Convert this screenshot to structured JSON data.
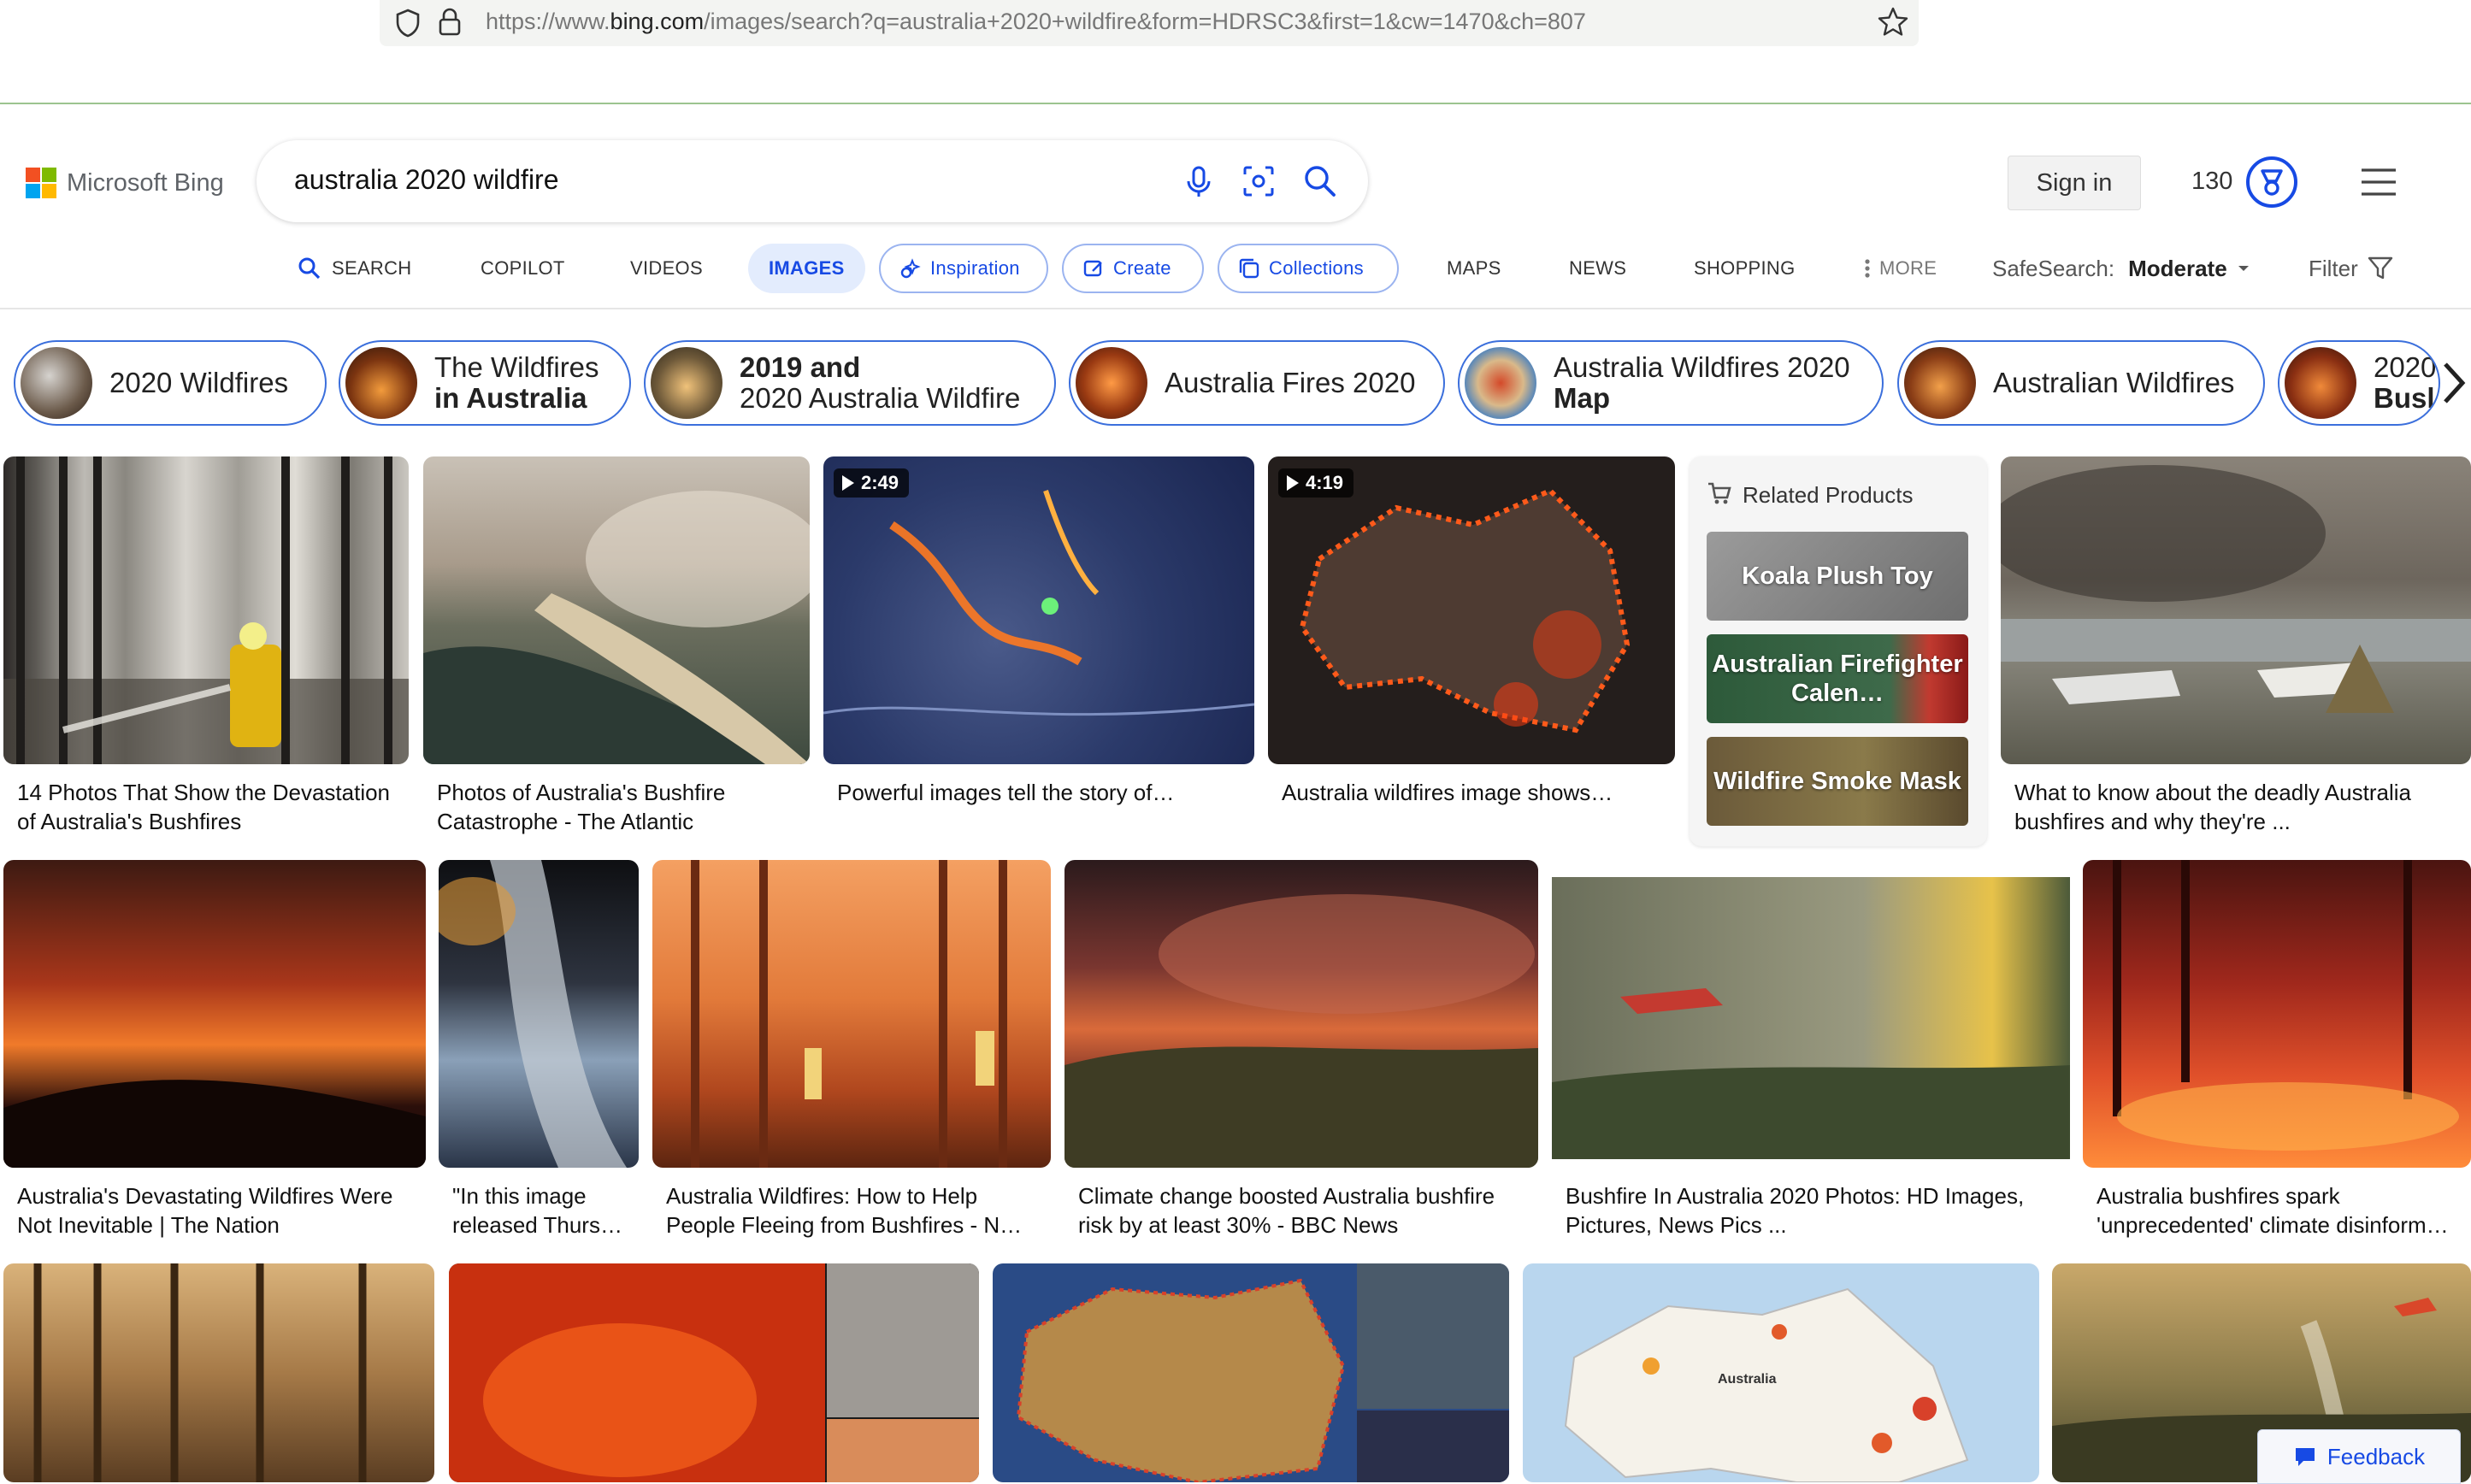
{
  "browser": {
    "url_prefix": "https://www.",
    "url_domain": "bing.com",
    "url_rest": "/images/search?q=australia+2020+wildfire&form=HDRSC3&first=1&cw=1470&ch=807"
  },
  "header": {
    "logo_text": "Microsoft Bing",
    "query": "australia 2020 wildfire",
    "sign_in": "Sign in",
    "points": "130"
  },
  "nav": {
    "tabs": [
      "SEARCH",
      "COPILOT",
      "VIDEOS",
      "IMAGES",
      "Inspiration",
      "Create",
      "Collections",
      "MAPS",
      "NEWS",
      "SHOPPING",
      "MORE"
    ],
    "safesearch_label": "SafeSearch:",
    "safesearch_value": "Moderate",
    "filter": "Filter"
  },
  "chips": [
    {
      "line1": "2020 Wildfires",
      "line2": ""
    },
    {
      "line1": "The Wildfires",
      "line2": "in Australia"
    },
    {
      "line1": "2019 and",
      "line2": "2020 Australia Wildfire"
    },
    {
      "line1": "Australia Fires 2020",
      "line2": ""
    },
    {
      "line1": "Australia Wildfires 2020",
      "line2": "Map"
    },
    {
      "line1": "Australian Wildfires",
      "line2": ""
    },
    {
      "line1": "2020",
      "line2": "Busl"
    }
  ],
  "results": {
    "row1": [
      {
        "caption1": "14 Photos That Show the Devastation",
        "caption2": "of Australia's Bushfires"
      },
      {
        "caption1": "Photos of Australia's Bushfire",
        "caption2": "Catastrophe - The Atlantic"
      },
      {
        "caption1": "Powerful images tell the story of…",
        "caption2": "",
        "duration": "2:49"
      },
      {
        "caption1": "Australia wildfires image shows…",
        "caption2": "",
        "duration": "4:19"
      },
      {
        "caption1": "What to know about the deadly Australia",
        "caption2": "bushfires and why they're ..."
      }
    ],
    "row2": [
      {
        "caption1": "Australia's Devastating Wildfires Were",
        "caption2": "Not Inevitable | The Nation"
      },
      {
        "caption1": "\"In this image",
        "caption2": "released Thurs…"
      },
      {
        "caption1": "Australia Wildfires: How to Help",
        "caption2": "People Fleeing from Bushfires - N…"
      },
      {
        "caption1": "Climate change boosted Australia bushfire",
        "caption2": "risk by at least 30% - BBC News"
      },
      {
        "caption1": "Bushfire In Australia 2020 Photos: HD Images,",
        "caption2": "Pictures, News Pics ..."
      },
      {
        "caption1": "Australia bushfires spark",
        "caption2": "'unprecedented' climate disinform…"
      }
    ]
  },
  "related_products": {
    "title": "Related Products",
    "items": [
      "Koala Plush Toy",
      "Australian Firefighter Calen…",
      "Wildfire Smoke Mask"
    ]
  },
  "map_label": "Australia",
  "feedback": "Feedback",
  "colors": {
    "accent": "#174ae4",
    "chip_border": "#3b6fdc"
  }
}
